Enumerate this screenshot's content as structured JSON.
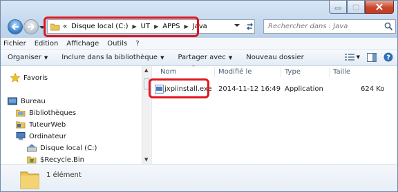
{
  "address": {
    "prefix": "«",
    "crumbs": [
      "Disque local (C:)",
      "UT",
      "APPS",
      "Java"
    ]
  },
  "search": {
    "placeholder": "Rechercher dans : Java"
  },
  "menu": [
    "Fichier",
    "Edition",
    "Affichage",
    "Outils",
    "?"
  ],
  "toolbar": {
    "organize": "Organiser",
    "include": "Inclure dans la bibliothèque",
    "share": "Partager avec",
    "new_folder": "Nouveau dossier"
  },
  "nav": {
    "favorites": "Favoris",
    "desktop": "Bureau",
    "libraries": "Bibliothèques",
    "tuteurweb": "TuteurWeb",
    "computer": "Ordinateur",
    "local_disk": "Disque local (C:)",
    "recycle": "$Recycle.Bin"
  },
  "columns": {
    "name": "Nom",
    "modified": "Modifié le",
    "type": "Type",
    "size": "Taille"
  },
  "files": [
    {
      "name": "jxpiinstall.exe",
      "modified": "2014-11-12 16:49",
      "type": "Application",
      "size": "624 Ko"
    }
  ],
  "status": {
    "count": "1 élément"
  },
  "colors": {
    "highlight": "#e2151b",
    "accent": "#2f78c2"
  },
  "icons": [
    "folder-icon",
    "back-arrow-icon",
    "forward-arrow-icon",
    "refresh-icon",
    "search-icon",
    "star-icon",
    "desktop-icon",
    "library-icon",
    "computer-icon",
    "drive-icon",
    "recycle-bin-icon",
    "exe-icon",
    "view-options-icon",
    "preview-pane-icon",
    "help-icon"
  ]
}
